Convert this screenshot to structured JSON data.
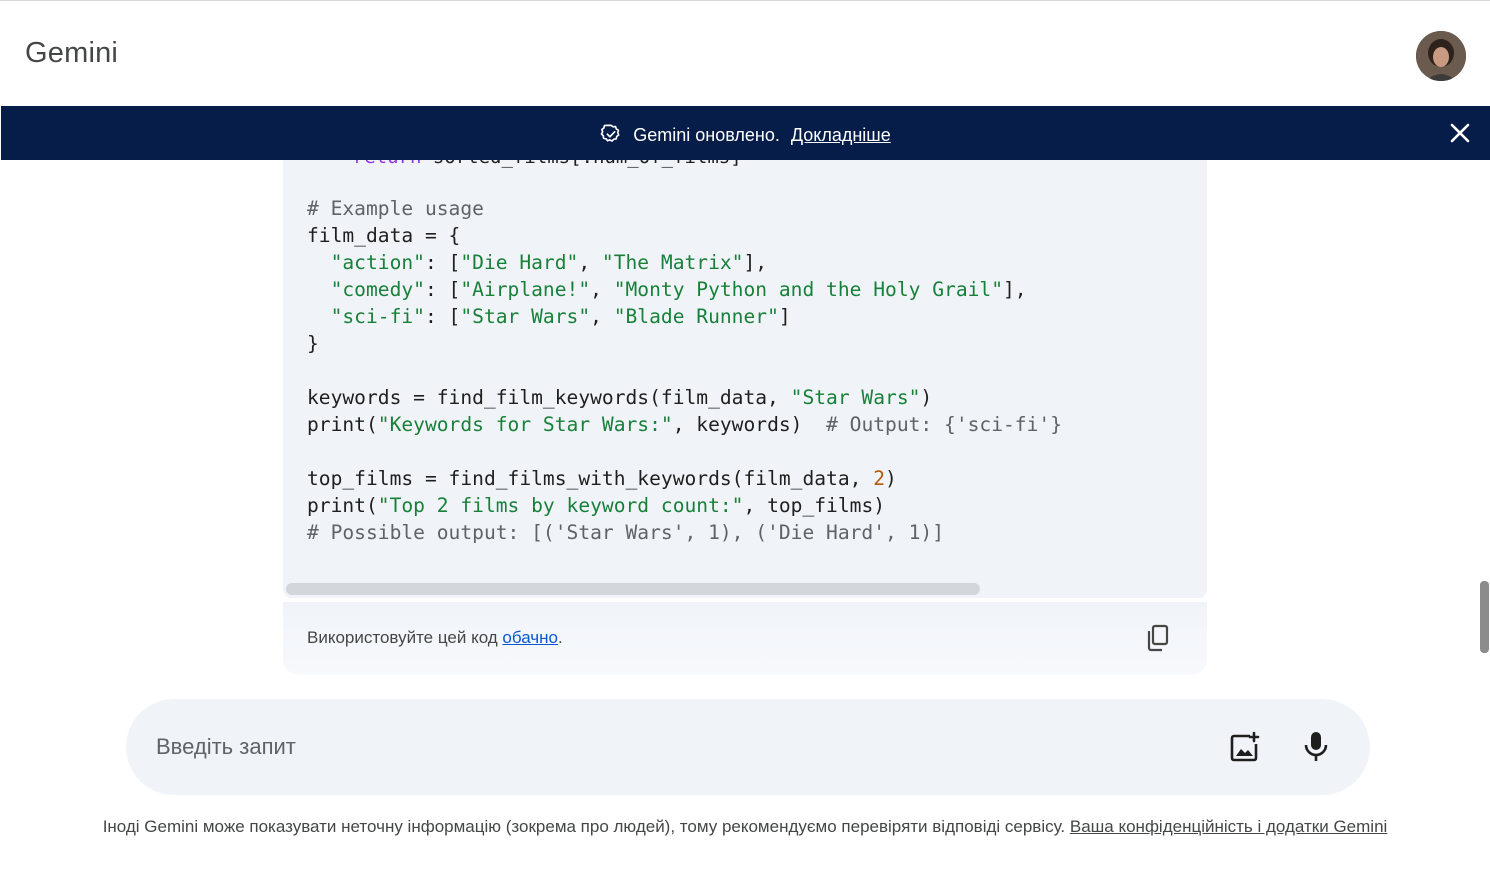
{
  "app": {
    "title": "Gemini"
  },
  "banner": {
    "message": "Gemini оновлено.",
    "link": "Докладніше"
  },
  "code": {
    "cut_line": "    return sorted_films[:num_of_films]",
    "lines": [
      [
        {
          "t": "# Example usage",
          "c": "cm"
        }
      ],
      [
        {
          "t": "film_data = {",
          "c": "pl"
        }
      ],
      [
        {
          "t": "  ",
          "c": "pl"
        },
        {
          "t": "\"action\"",
          "c": "str"
        },
        {
          "t": ": [",
          "c": "pl"
        },
        {
          "t": "\"Die Hard\"",
          "c": "str"
        },
        {
          "t": ", ",
          "c": "pl"
        },
        {
          "t": "\"The Matrix\"",
          "c": "str"
        },
        {
          "t": "],",
          "c": "pl"
        }
      ],
      [
        {
          "t": "  ",
          "c": "pl"
        },
        {
          "t": "\"comedy\"",
          "c": "str"
        },
        {
          "t": ": [",
          "c": "pl"
        },
        {
          "t": "\"Airplane!\"",
          "c": "str"
        },
        {
          "t": ", ",
          "c": "pl"
        },
        {
          "t": "\"Monty Python and the Holy Grail\"",
          "c": "str"
        },
        {
          "t": "],",
          "c": "pl"
        }
      ],
      [
        {
          "t": "  ",
          "c": "pl"
        },
        {
          "t": "\"sci-fi\"",
          "c": "str"
        },
        {
          "t": ": [",
          "c": "pl"
        },
        {
          "t": "\"Star Wars\"",
          "c": "str"
        },
        {
          "t": ", ",
          "c": "pl"
        },
        {
          "t": "\"Blade Runner\"",
          "c": "str"
        },
        {
          "t": "]",
          "c": "pl"
        }
      ],
      [
        {
          "t": "}",
          "c": "pl"
        }
      ],
      [
        {
          "t": "",
          "c": "pl"
        }
      ],
      [
        {
          "t": "keywords = find_film_keywords(film_data, ",
          "c": "pl"
        },
        {
          "t": "\"Star Wars\"",
          "c": "str"
        },
        {
          "t": ")",
          "c": "pl"
        }
      ],
      [
        {
          "t": "print(",
          "c": "pl"
        },
        {
          "t": "\"Keywords for Star Wars:\"",
          "c": "str"
        },
        {
          "t": ", keywords)  ",
          "c": "pl"
        },
        {
          "t": "# Output: {'sci-fi'}",
          "c": "cm"
        }
      ],
      [
        {
          "t": "",
          "c": "pl"
        }
      ],
      [
        {
          "t": "top_films = find_films_with_keywords(film_data, ",
          "c": "pl"
        },
        {
          "t": "2",
          "c": "num"
        },
        {
          "t": ")",
          "c": "pl"
        }
      ],
      [
        {
          "t": "print(",
          "c": "pl"
        },
        {
          "t": "\"Top 2 films by keyword count:\"",
          "c": "str"
        },
        {
          "t": ", top_films)",
          "c": "pl"
        }
      ],
      [
        {
          "t": "# Possible output: [('Star Wars', 1), ('Die Hard', 1)]",
          "c": "cm"
        }
      ]
    ]
  },
  "code_footer": {
    "note_prefix": "Використовуйте цей код ",
    "note_link": "обачно",
    "note_suffix": "."
  },
  "prompt": {
    "placeholder": "Введіть запит"
  },
  "disclaimer": {
    "text": "Іноді Gemini може показувати неточну інформацію (зокрема про людей), тому рекомендуємо перевіряти відповіді сервісу. ",
    "link": "Ваша конфіденційність і додатки Gemini"
  },
  "icons": {
    "banner": "check-badge-icon",
    "close": "close-icon",
    "copy": "copy-icon",
    "add_image": "add-image-icon",
    "mic": "microphone-icon"
  },
  "colors": {
    "banner_bg": "#071d49",
    "code_bg": "#f0f4f9",
    "string": "#188038",
    "number": "#b55908",
    "link": "#0b57d0"
  }
}
